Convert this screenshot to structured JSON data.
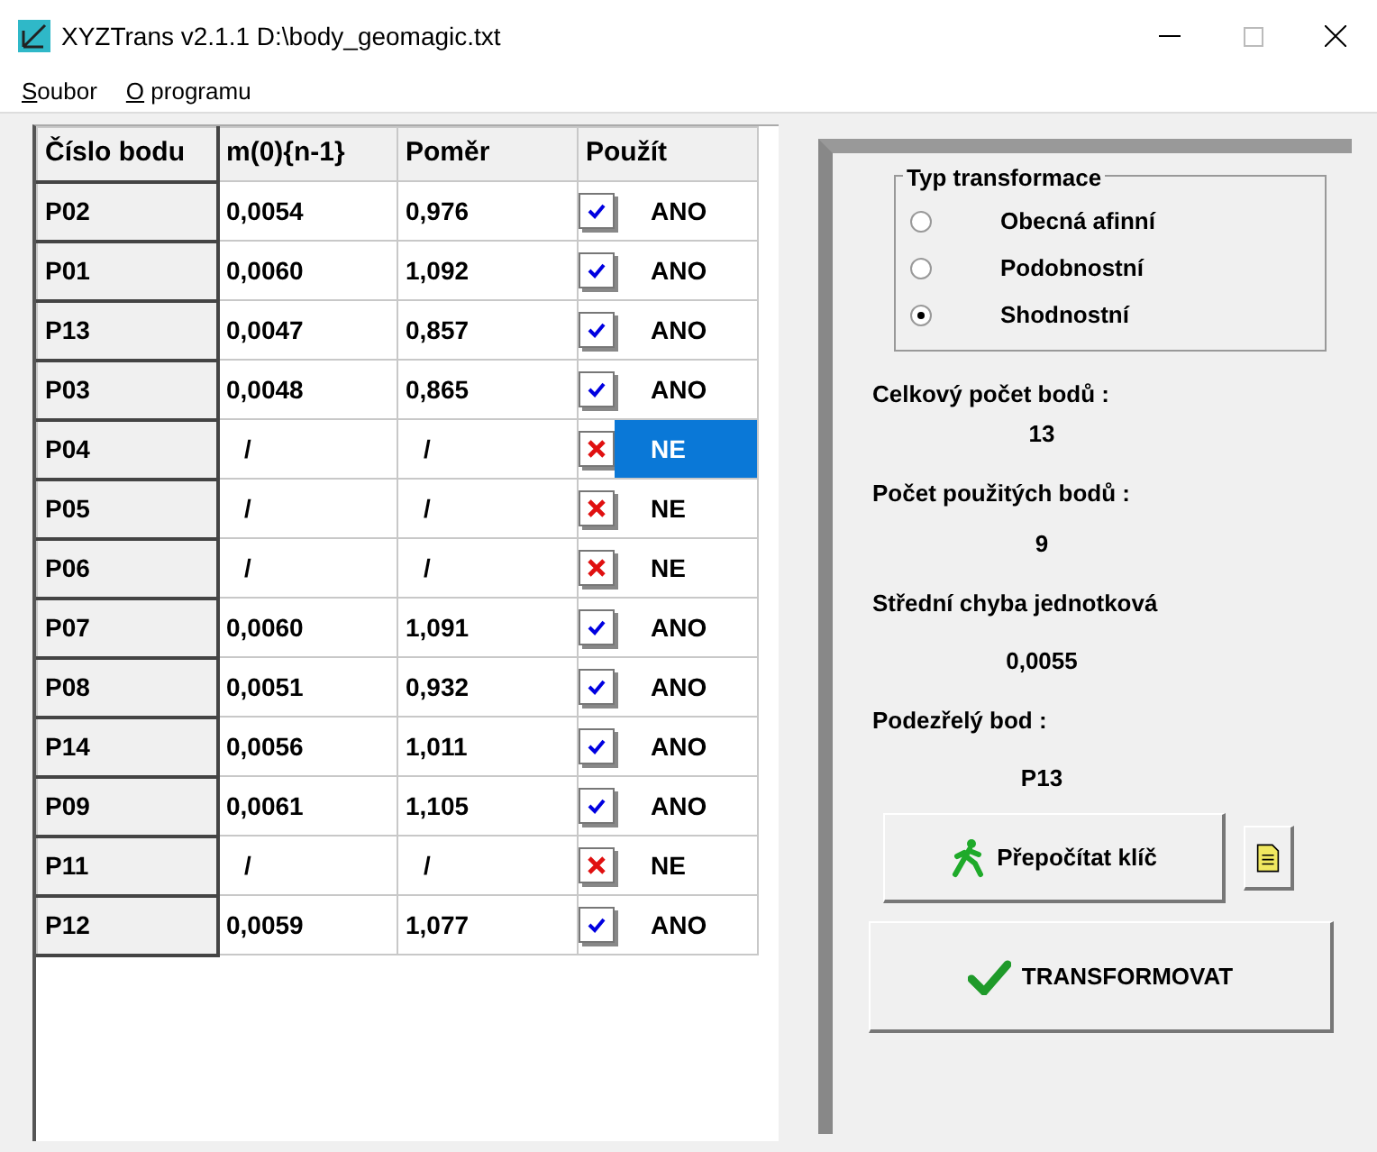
{
  "window": {
    "title": "XYZTrans v2.1.1 D:\\body_geomagic.txt"
  },
  "menu": [
    "Soubor",
    "O programu"
  ],
  "table": {
    "columns": [
      "Číslo bodu",
      "m(0){n-1}",
      "Poměr",
      "Použít"
    ],
    "rows": [
      {
        "point": "P02",
        "m0": "0,0054",
        "ratio": "0,976",
        "kind": "tick",
        "used_text": "ANO",
        "selected": false
      },
      {
        "point": "P01",
        "m0": "0,0060",
        "ratio": "1,092",
        "kind": "tick",
        "used_text": "ANO",
        "selected": false
      },
      {
        "point": "P13",
        "m0": "0,0047",
        "ratio": "0,857",
        "kind": "tick",
        "used_text": "ANO",
        "selected": false
      },
      {
        "point": "P03",
        "m0": "0,0048",
        "ratio": "0,865",
        "kind": "tick",
        "used_text": "ANO",
        "selected": false
      },
      {
        "point": "P04",
        "m0": "/",
        "ratio": "/",
        "kind": "cross",
        "used_text": "NE",
        "selected": true
      },
      {
        "point": "P05",
        "m0": "/",
        "ratio": "/",
        "kind": "cross",
        "used_text": "NE",
        "selected": false
      },
      {
        "point": "P06",
        "m0": "/",
        "ratio": "/",
        "kind": "cross",
        "used_text": "NE",
        "selected": false
      },
      {
        "point": "P07",
        "m0": "0,0060",
        "ratio": "1,091",
        "kind": "tick",
        "used_text": "ANO",
        "selected": false
      },
      {
        "point": "P08",
        "m0": "0,0051",
        "ratio": "0,932",
        "kind": "tick",
        "used_text": "ANO",
        "selected": false
      },
      {
        "point": "P14",
        "m0": "0,0056",
        "ratio": "1,011",
        "kind": "tick",
        "used_text": "ANO",
        "selected": false
      },
      {
        "point": "P09",
        "m0": "0,0061",
        "ratio": "1,105",
        "kind": "tick",
        "used_text": "ANO",
        "selected": false
      },
      {
        "point": "P11",
        "m0": "/",
        "ratio": "/",
        "kind": "cross",
        "used_text": "NE",
        "selected": false
      },
      {
        "point": "P12",
        "m0": "0,0059",
        "ratio": "1,077",
        "kind": "tick",
        "used_text": "ANO",
        "selected": false
      }
    ]
  },
  "transform_type": {
    "title": "Typ transformace",
    "options": [
      {
        "label": "Obecná afinní",
        "selected": false
      },
      {
        "label": "Podobnostní",
        "selected": false
      },
      {
        "label": "Shodnostní",
        "selected": true
      }
    ]
  },
  "stats": [
    {
      "label": "Celkový počet bodů :",
      "value": "13"
    },
    {
      "label": "Počet použitých bodů :",
      "value": "9"
    },
    {
      "label": "Střední chyba jednotková",
      "value": "0,0055"
    },
    {
      "label": "Podezřelý bod :",
      "value": "P13"
    }
  ],
  "buttons": {
    "recalc": "Přepočítat klíč",
    "transform": "TRANSFORMOVAT"
  }
}
